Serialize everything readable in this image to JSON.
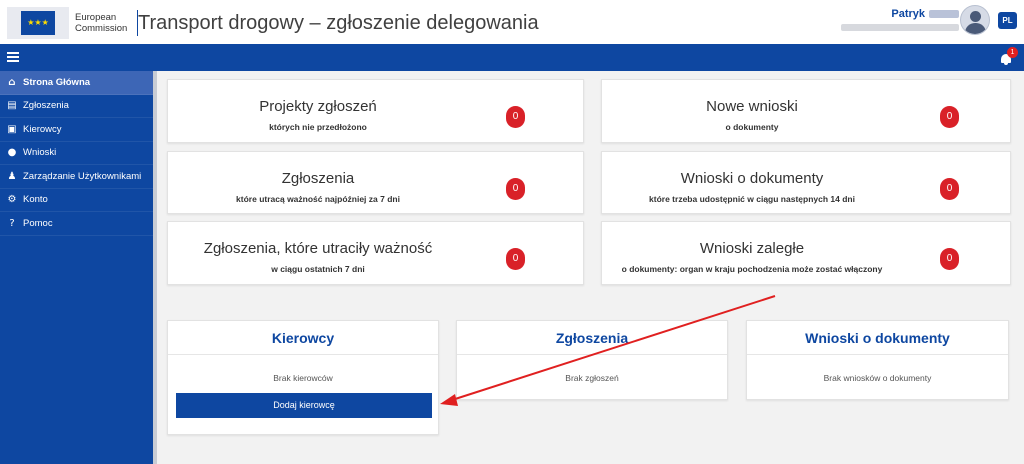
{
  "header": {
    "logo_line1": "European",
    "logo_line2": "Commission",
    "app_title": "Transport drogowy – zgłoszenie delegowania",
    "user_name": "Patryk",
    "language": "PL",
    "notifications_count": "1"
  },
  "sidebar": {
    "items": [
      {
        "label": "Strona Główna",
        "icon": "home-icon",
        "active": true
      },
      {
        "label": "Zgłoszenia",
        "icon": "document-icon"
      },
      {
        "label": "Kierowcy",
        "icon": "bus-icon"
      },
      {
        "label": "Wnioski",
        "icon": "chat-icon"
      },
      {
        "label": "Zarządzanie Użytkownikami",
        "icon": "users-icon"
      },
      {
        "label": "Konto",
        "icon": "gear-icon"
      },
      {
        "label": "Pomoc",
        "icon": "help-icon"
      }
    ]
  },
  "stats": {
    "cards": [
      {
        "title": "Projekty zgłoszeń",
        "subtitle": "których nie przedłożono",
        "count": "0"
      },
      {
        "title": "Nowe wnioski",
        "subtitle": "o dokumenty",
        "count": "0"
      },
      {
        "title": "Zgłoszenia",
        "subtitle": "które utracą ważność najpóźniej za 7 dni",
        "count": "0"
      },
      {
        "title": "Wnioski o dokumenty",
        "subtitle": "które trzeba udostępnić w ciągu następnych 14 dni",
        "count": "0"
      },
      {
        "title": "Zgłoszenia, które utraciły ważność",
        "subtitle": "w ciągu ostatnich 7 dni",
        "count": "0"
      },
      {
        "title": "Wnioski zaległe",
        "subtitle": "o dokumenty: organ w kraju pochodzenia może zostać włączony",
        "count": "0"
      }
    ]
  },
  "panels": {
    "drivers": {
      "title": "Kierowcy",
      "empty": "Brak kierowców",
      "button": "Dodaj kierowcę"
    },
    "declarations": {
      "title": "Zgłoszenia",
      "empty": "Brak zgłoszeń"
    },
    "requests": {
      "title": "Wnioski o dokumenty",
      "empty": "Brak wniosków o dokumenty"
    }
  },
  "colors": {
    "brand": "#0e47a1",
    "badge": "#d92128",
    "annotation_arrow": "#e02020"
  }
}
